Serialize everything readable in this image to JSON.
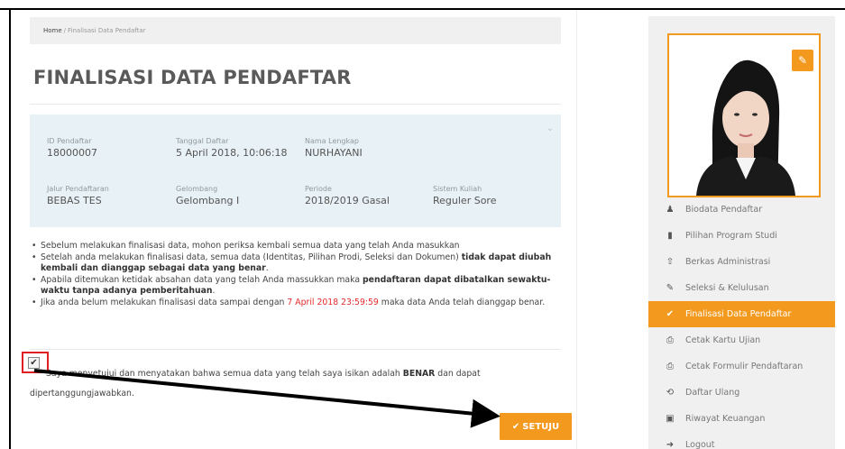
{
  "breadcrumb": {
    "home": "Home",
    "separator": "/",
    "current": "Finalisasi Data Pendaftar"
  },
  "page_title": "FINALISASI DATA PENDAFTAR",
  "info": {
    "id_label": "ID Pendaftar",
    "id_value": "18000007",
    "tanggal_label": "Tanggal Daftar",
    "tanggal_value": "5 April 2018, 10:06:18",
    "nama_label": "Nama Lengkap",
    "nama_value": "NURHAYANI",
    "jalur_label": "Jalur Pendaftaran",
    "jalur_value": "BEBAS TES",
    "gelombang_label": "Gelombang",
    "gelombang_value": "Gelombang I",
    "periode_label": "Periode",
    "periode_value": "2018/2019 Gasal",
    "sistem_label": "Sistem Kuliah",
    "sistem_value": "Reguler Sore"
  },
  "notes": {
    "n1": "Sebelum melakukan finalisasi data, mohon periksa kembali semua data yang telah Anda masukkan",
    "n2_a": "Setelah anda melakukan finalisasi data, semua data (Identitas, Pilihan Prodi, Seleksi dan Dokumen) ",
    "n2_b": "tidak dapat diubah kembali dan dianggap sebagai data yang benar",
    "n2_c": ".",
    "n3_a": "Apabila ditemukan ketidak absahan data yang telah Anda massukkan maka ",
    "n3_b": "pendaftaran dapat dibatalkan sewaktu-waktu tanpa adanya pemberitahuan",
    "n3_c": ".",
    "n4_a": "Jika anda belum melakukan finalisasi data sampai dengan ",
    "n4_deadline": "7 April 2018 23:59:59",
    "n4_b": " maka data Anda telah dianggap benar."
  },
  "agree": {
    "text_a": "Saya menyetujui dan menyatakan bahwa semua data yang telah saya isikan adalah ",
    "text_bold": "BENAR",
    "text_b": " dan dapat dipertanggungjawabkan.",
    "checked": true,
    "check_mark": "✔"
  },
  "setuju_button": {
    "label": "SETUJU",
    "icon": "check-icon",
    "color": "#f39a1e"
  },
  "sidebar": {
    "edit_icon": "pencil-icon",
    "items": [
      {
        "label": "Biodata Pendaftar",
        "icon": "user-icon",
        "glyph": "♟"
      },
      {
        "label": "Pilihan Program Studi",
        "icon": "bookmark-icon",
        "glyph": "▮"
      },
      {
        "label": "Berkas Administrasi",
        "icon": "upload-icon",
        "glyph": "⇧"
      },
      {
        "label": "Seleksi & Kelulusan",
        "icon": "edit-icon",
        "glyph": "✎"
      },
      {
        "label": "Finalisasi Data Pendaftar",
        "icon": "check-icon",
        "glyph": "✔",
        "active": true
      },
      {
        "label": "Cetak Kartu Ujian",
        "icon": "print-icon",
        "glyph": "⎙"
      },
      {
        "label": "Cetak Formulir Pendaftaran",
        "icon": "print-icon",
        "glyph": "⎙"
      },
      {
        "label": "Daftar Ulang",
        "icon": "refresh-icon",
        "glyph": "⟲"
      },
      {
        "label": "Riwayat Keuangan",
        "icon": "money-icon",
        "glyph": "▣"
      },
      {
        "label": "Logout",
        "icon": "logout-icon",
        "glyph": "➜"
      }
    ]
  },
  "colors": {
    "accent": "#f39a1e",
    "info_bg": "#e8f1f6",
    "deadline_red": "#e52b2b",
    "highlight_red": "#e02020"
  }
}
